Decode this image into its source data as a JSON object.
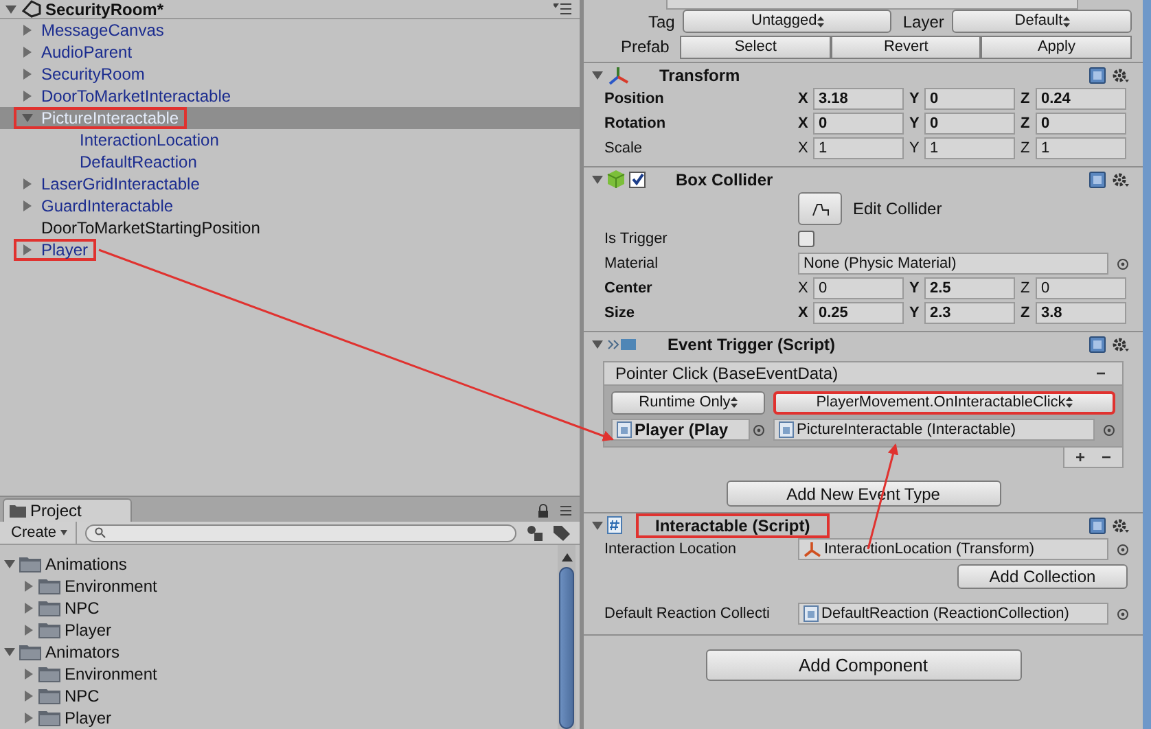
{
  "hierarchy": {
    "title": "SecurityRoom*",
    "items": [
      {
        "label": "MessageCanvas",
        "prefab": true,
        "expanded": false,
        "selected": false,
        "highlighted": false
      },
      {
        "label": "AudioParent",
        "prefab": true,
        "expanded": false,
        "selected": false,
        "highlighted": false
      },
      {
        "label": "SecurityRoom",
        "prefab": true,
        "expanded": false,
        "selected": false,
        "highlighted": false
      },
      {
        "label": "DoorToMarketInteractable",
        "prefab": true,
        "expanded": false,
        "selected": false,
        "highlighted": false
      },
      {
        "label": "PictureInteractable",
        "prefab": true,
        "expanded": true,
        "selected": true,
        "highlighted": true,
        "children": [
          {
            "label": "InteractionLocation",
            "prefab": true,
            "selected": false,
            "highlighted": false
          },
          {
            "label": "DefaultReaction",
            "prefab": true,
            "selected": false,
            "highlighted": false
          }
        ]
      },
      {
        "label": "LaserGridInteractable",
        "prefab": true,
        "expanded": false,
        "selected": false,
        "highlighted": false
      },
      {
        "label": "GuardInteractable",
        "prefab": true,
        "expanded": false,
        "selected": false,
        "highlighted": false
      },
      {
        "label": "DoorToMarketStartingPosition",
        "prefab": false,
        "selected": false,
        "highlighted": false
      },
      {
        "label": "Player",
        "prefab": true,
        "expanded": false,
        "selected": false,
        "highlighted": true
      }
    ]
  },
  "project": {
    "tab": "Project",
    "create": "Create",
    "items": [
      {
        "label": "Animations",
        "expanded": true,
        "children": [
          {
            "label": "Environment",
            "expanded": false
          },
          {
            "label": "NPC",
            "expanded": false
          },
          {
            "label": "Player",
            "expanded": false
          }
        ]
      },
      {
        "label": "Animators",
        "expanded": true,
        "children": [
          {
            "label": "Environment",
            "expanded": false
          },
          {
            "label": "NPC",
            "expanded": false
          },
          {
            "label": "Player",
            "expanded": false
          }
        ]
      }
    ]
  },
  "inspector": {
    "tag": {
      "label": "Tag",
      "value": "Untagged"
    },
    "layer": {
      "label": "Layer",
      "value": "Default"
    },
    "prefab": {
      "label": "Prefab",
      "buttons": [
        "Select",
        "Revert",
        "Apply"
      ]
    },
    "components": [
      {
        "kind": "transform",
        "title": "Transform",
        "highlighted": false,
        "rows": [
          {
            "label": "Position",
            "bold": true,
            "fields": [
              {
                "axis": "X",
                "value": "3.18",
                "bold": true
              },
              {
                "axis": "Y",
                "value": "0",
                "bold": true
              },
              {
                "axis": "Z",
                "value": "0.24",
                "bold": true
              }
            ]
          },
          {
            "label": "Rotation",
            "bold": true,
            "fields": [
              {
                "axis": "X",
                "value": "0",
                "bold": true
              },
              {
                "axis": "Y",
                "value": "0",
                "bold": true
              },
              {
                "axis": "Z",
                "value": "0",
                "bold": true
              }
            ]
          },
          {
            "label": "Scale",
            "bold": false,
            "fields": [
              {
                "axis": "X",
                "value": "1",
                "bold": false
              },
              {
                "axis": "Y",
                "value": "1",
                "bold": false
              },
              {
                "axis": "Z",
                "value": "1",
                "bold": false
              }
            ]
          }
        ]
      },
      {
        "kind": "box_collider",
        "title": "Box Collider",
        "highlighted": false,
        "enabled": true,
        "edit_button": "Edit Collider",
        "is_trigger": {
          "label": "Is Trigger",
          "checked": false
        },
        "material": {
          "label": "Material",
          "value": "None (Physic Material)"
        },
        "rows": [
          {
            "label": "Center",
            "bold": true,
            "fields": [
              {
                "axis": "X",
                "value": "0",
                "bold": false
              },
              {
                "axis": "Y",
                "value": "2.5",
                "bold": true
              },
              {
                "axis": "Z",
                "value": "0",
                "bold": false
              }
            ]
          },
          {
            "label": "Size",
            "bold": true,
            "fields": [
              {
                "axis": "X",
                "value": "0.25",
                "bold": true
              },
              {
                "axis": "Y",
                "value": "2.3",
                "bold": true
              },
              {
                "axis": "Z",
                "value": "3.8",
                "bold": true
              }
            ]
          }
        ]
      },
      {
        "kind": "event_trigger",
        "title": "Event Trigger (Script)",
        "highlighted": false,
        "event": "Pointer Click (BaseEventData)",
        "remove": "−",
        "runtime": "Runtime Only",
        "function": "PlayerMovement.OnInteractableClick",
        "function_highlighted": true,
        "target": "Player (Play",
        "argument": "PictureInteractable (Interactable)",
        "add": "+",
        "remove_listener": "−",
        "add_button": "Add New Event Type"
      },
      {
        "kind": "interactable",
        "title": "Interactable (Script)",
        "highlighted": true,
        "location": {
          "label": "Interaction Location",
          "value": "InteractionLocation (Transform)"
        },
        "add_collection": "Add Collection",
        "reaction": {
          "label": "Default Reaction Collecti",
          "value": "DefaultReaction (ReactionCollection)"
        }
      }
    ],
    "add_component": "Add Component"
  }
}
